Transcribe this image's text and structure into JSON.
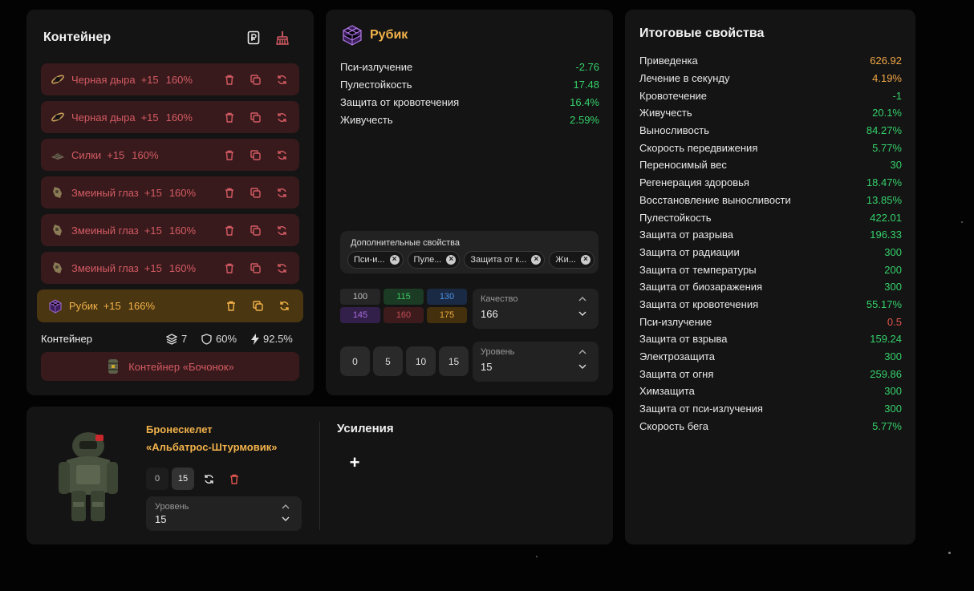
{
  "container": {
    "title": "Контейнер",
    "artifacts": [
      {
        "name": "Черная дыра",
        "level": "+15",
        "percent": "160%",
        "icon": "black-hole-icon"
      },
      {
        "name": "Черная дыра",
        "level": "+15",
        "percent": "160%",
        "icon": "black-hole-icon"
      },
      {
        "name": "Силки",
        "level": "+15",
        "percent": "160%",
        "icon": "snare-icon"
      },
      {
        "name": "Змеиный глаз",
        "level": "+15",
        "percent": "160%",
        "icon": "snake-eye-icon"
      },
      {
        "name": "Змеиный глаз",
        "level": "+15",
        "percent": "160%",
        "icon": "snake-eye-icon"
      },
      {
        "name": "Змеиный глаз",
        "level": "+15",
        "percent": "160%",
        "icon": "snake-eye-icon"
      },
      {
        "name": "Рубик",
        "level": "+15",
        "percent": "166%",
        "icon": "rubik-icon",
        "active": true
      }
    ],
    "footer_label": "Контейнер",
    "stats": {
      "slots": "7",
      "protection": "60%",
      "efficiency": "92.5%"
    },
    "selected_container": "Контейнер «Бочонок»"
  },
  "artifact": {
    "name": "Рубик",
    "properties": [
      {
        "name": "Пси-излучение",
        "value": "-2.76"
      },
      {
        "name": "Пулестойкость",
        "value": "17.48"
      },
      {
        "name": "Защита от кровотечения",
        "value": "16.4%"
      },
      {
        "name": "Живучесть",
        "value": "2.59%"
      }
    ],
    "extra_label": "Дополнительные свойства",
    "extra_chips": [
      "Пси-и...",
      "Пуле...",
      "Защита от к...",
      "Жи..."
    ],
    "quality_presets": [
      {
        "label": "100",
        "bg": "#262626",
        "fg": "#bdbdbd"
      },
      {
        "label": "115",
        "bg": "#1b3b24",
        "fg": "#3cc462"
      },
      {
        "label": "130",
        "bg": "#1b2a44",
        "fg": "#4d8ee0"
      },
      {
        "label": "145",
        "bg": "#33204a",
        "fg": "#a66ad9"
      },
      {
        "label": "160",
        "bg": "#3d1b1d",
        "fg": "#c54d55"
      },
      {
        "label": "175",
        "bg": "#45300e",
        "fg": "#e6a93a"
      }
    ],
    "quality": {
      "label": "Качество",
      "value": "166"
    },
    "level_presets": [
      "0",
      "5",
      "10",
      "15"
    ],
    "level": {
      "label": "Уровень",
      "value": "15"
    }
  },
  "summary": {
    "title": "Итоговые свойства",
    "rows": [
      {
        "name": "Приведенка",
        "value": "626.92",
        "color": "#f0a646"
      },
      {
        "name": "Лечение в секунду",
        "value": "4.19%",
        "color": "#f0a646"
      },
      {
        "name": "Кровотечение",
        "value": "-1",
        "color": "#35d06a"
      },
      {
        "name": "Живучесть",
        "value": "20.1%",
        "color": "#35d06a"
      },
      {
        "name": "Выносливость",
        "value": "84.27%",
        "color": "#35d06a"
      },
      {
        "name": "Скорость передвижения",
        "value": "5.77%",
        "color": "#35d06a"
      },
      {
        "name": "Переносимый вес",
        "value": "30",
        "color": "#35d06a"
      },
      {
        "name": "Регенерация здоровья",
        "value": "18.47%",
        "color": "#35d06a"
      },
      {
        "name": "Восстановление выносливости",
        "value": "13.85%",
        "color": "#35d06a"
      },
      {
        "name": "Пулестойкость",
        "value": "422.01",
        "color": "#35d06a"
      },
      {
        "name": "Защита от разрыва",
        "value": "196.33",
        "color": "#35d06a"
      },
      {
        "name": "Защита от радиации",
        "value": "300",
        "color": "#35d06a"
      },
      {
        "name": "Защита от температуры",
        "value": "200",
        "color": "#35d06a"
      },
      {
        "name": "Защита от биозаражения",
        "value": "300",
        "color": "#35d06a"
      },
      {
        "name": "Защита от кровотечения",
        "value": "55.17%",
        "color": "#35d06a"
      },
      {
        "name": "Пси-излучение",
        "value": "0.5",
        "color": "#e0564f"
      },
      {
        "name": "Защита от взрыва",
        "value": "159.24",
        "color": "#35d06a"
      },
      {
        "name": "Электрозащита",
        "value": "300",
        "color": "#35d06a"
      },
      {
        "name": "Защита от огня",
        "value": "259.86",
        "color": "#35d06a"
      },
      {
        "name": "Химзащита",
        "value": "300",
        "color": "#35d06a"
      },
      {
        "name": "Защита от пси-излучения",
        "value": "300",
        "color": "#35d06a"
      },
      {
        "name": "Скорость бега",
        "value": "5.77%",
        "color": "#35d06a"
      }
    ]
  },
  "armor": {
    "name_line1": "Бронескелет",
    "name_line2": "«Альбатрос-Штурмовик»",
    "level_min": "0",
    "level_max": "15",
    "level": {
      "label": "Уровень",
      "value": "15"
    },
    "boosts_title": "Усиления",
    "add_symbol": "+"
  },
  "colors": {
    "accent": "#f2b24a",
    "positive": "#35d06a",
    "negative": "#e0564f",
    "artifact_row_bg": "#391a1c",
    "artifact_row_fg": "#d35b63"
  }
}
